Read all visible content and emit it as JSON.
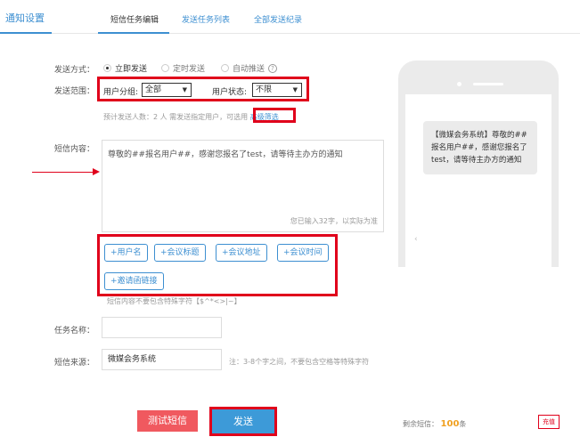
{
  "nav": {
    "section_title": "通知设置",
    "tabs": [
      {
        "label": "短信任务编辑"
      },
      {
        "label": "发送任务列表"
      },
      {
        "label": "全部发送纪录"
      }
    ]
  },
  "form": {
    "send_method_label": "发送方式：",
    "send_methods": [
      "立即发送",
      "定时发送",
      "自动推送"
    ],
    "help_icon": "?",
    "send_range_label": "发送范围：",
    "user_group_label": "用户分组:",
    "user_group_value": "全部",
    "user_status_label": "用户状态:",
    "user_status_value": "不限",
    "hint_text": "预计发送人数：2 人 需发送指定用户，可选用",
    "hint_link": "高级筛选",
    "content_label": "短信内容：",
    "content_value": "尊敬的##报名用户##，感谢您报名了test，请等待主办方的通知",
    "counter": "您已输入32字，以实际为准",
    "tags": [
      "+用户名",
      "+会议标题",
      "+会议地址",
      "+会议时间",
      "+邀请函链接"
    ],
    "tags_hint": "短信内容不要包含特殊字符【$^*<>|~】",
    "task_name_label": "任务名称：",
    "task_name_value": "",
    "source_label": "短信来源：",
    "source_value": "微媒会务系统",
    "source_hint": "注：3-8个字之间，不要包含空格等特殊字符"
  },
  "actions": {
    "test_label": "测试短信",
    "send_label": "发送",
    "remain_label": "剩余短信：",
    "remain_count": "100",
    "remain_unit": "条",
    "recharge_label": "充值"
  },
  "preview": {
    "message": "【微媒会务系统】尊敬的##报名用户##，感谢您报名了test，请等待主办方的通知",
    "caret": "‹"
  },
  "colors": {
    "accent": "#3d8fd1",
    "highlight": "#e0001b",
    "test_button": "#f0595f",
    "send_button": "#3d9ad8",
    "remain_number": "#f0a020"
  }
}
